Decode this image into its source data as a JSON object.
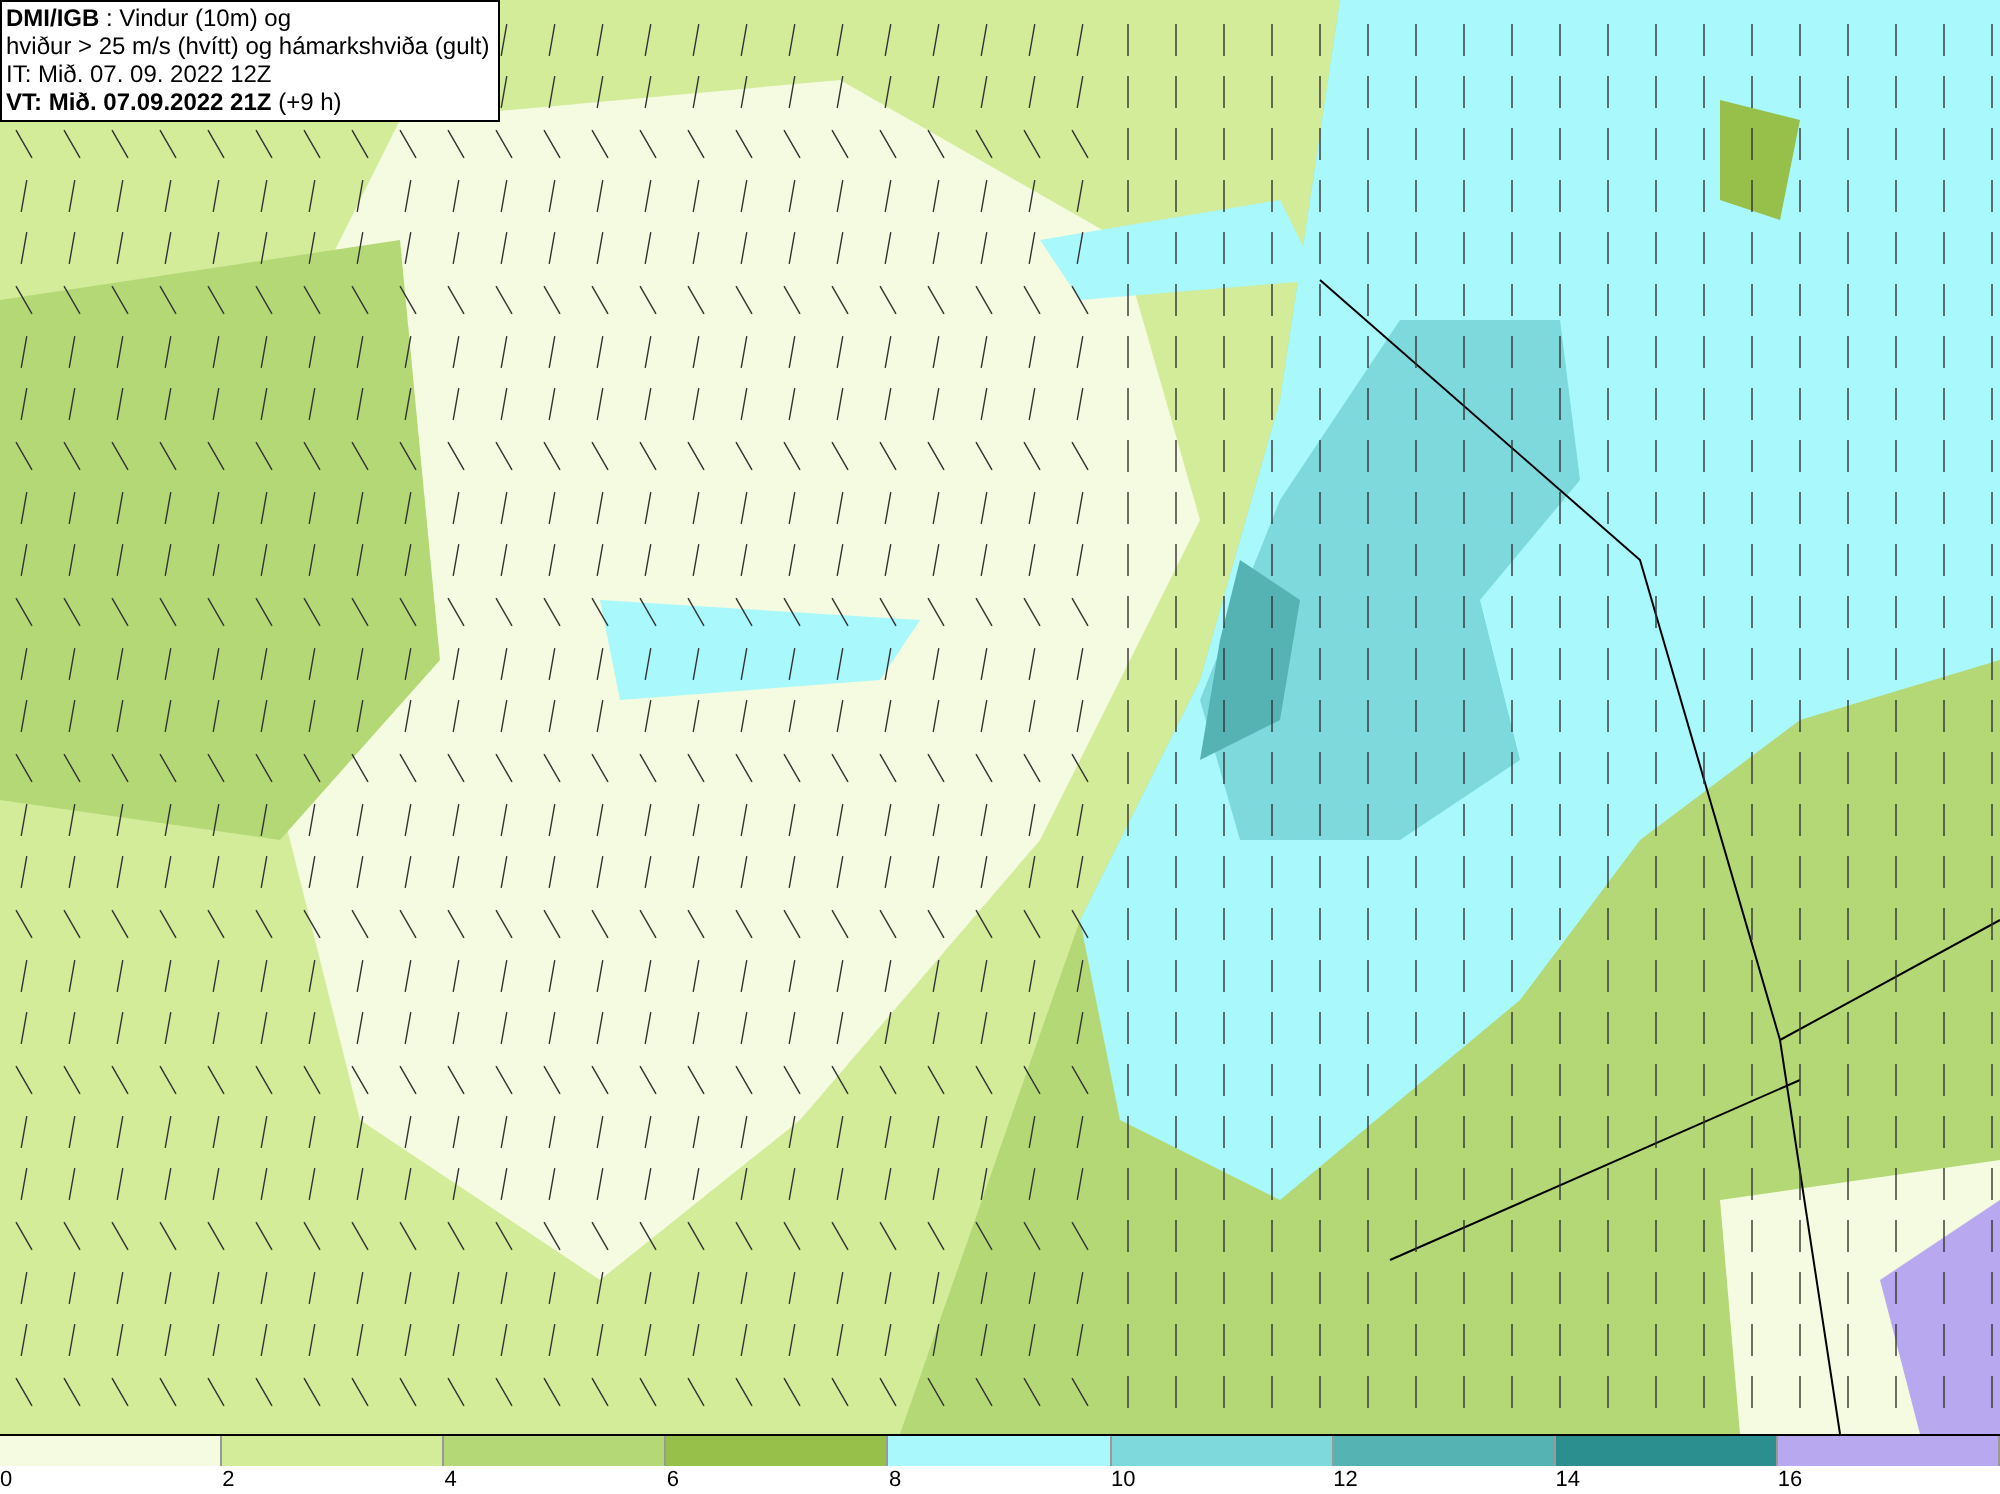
{
  "title_box": {
    "lines": [
      "**DMI/IGB** : Vindur (10m) og",
      "hviður > 25 m/s (hvítt) og hámarkshviða (gult)",
      "IT: Mið. 07. 09. 2022 12Z",
      "**VT: Mið. 07.09.2022 21Z** (+9 h)"
    ]
  },
  "legend": [
    {
      "label": "0",
      "color": "#f5fbe0"
    },
    {
      "label": "2",
      "color": "#d2ec9a"
    },
    {
      "label": "4",
      "color": "#b5d877"
    },
    {
      "label": "6",
      "color": "#97c04a"
    },
    {
      "label": "8",
      "color": "#a8f8fc"
    },
    {
      "label": "10",
      "color": "#7dd9dc"
    },
    {
      "label": "12",
      "color": "#55b3b3"
    },
    {
      "label": "14",
      "color": "#2a8f8e"
    },
    {
      "label": "16",
      "color": "#b8a8f0"
    }
  ]
}
